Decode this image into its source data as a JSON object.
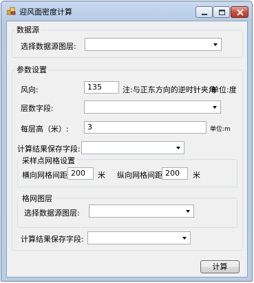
{
  "window": {
    "title": "迎风面密度计算"
  },
  "data_source": {
    "group_title": "数据源",
    "layer_label": "选择数据源图层:",
    "layer_value": ""
  },
  "params": {
    "group_title": "参数设置",
    "wind_label": "风向:",
    "wind_value": "135",
    "wind_note": "注:与正东方向的逆时针夹角",
    "wind_unit": "单位:度",
    "floor_field_label": "层数字段:",
    "floor_field_value": "",
    "floor_height_label": "每层高（米）:",
    "floor_height_value": "3",
    "floor_height_unit": "单位:m",
    "save_field_label": "计算结果保存字段:",
    "save_field_value": ""
  },
  "sampling": {
    "group_title": "采样点网格设置",
    "h_label": "横向网格间距:",
    "h_value": "200",
    "h_unit": "米",
    "v_label": "纵向网格间距:",
    "v_value": "200",
    "v_unit": "米"
  },
  "grid_layer": {
    "group_title": "格网图层",
    "layer_label": "选择数据源图层:",
    "layer_value": ""
  },
  "grid_save": {
    "label": "计算结果保存字段:",
    "value": ""
  },
  "actions": {
    "calc_label": "计算"
  },
  "colors": {
    "titlebar": "#b9cde8",
    "client": "#f0f0f0",
    "close_button": "#c9513f"
  }
}
